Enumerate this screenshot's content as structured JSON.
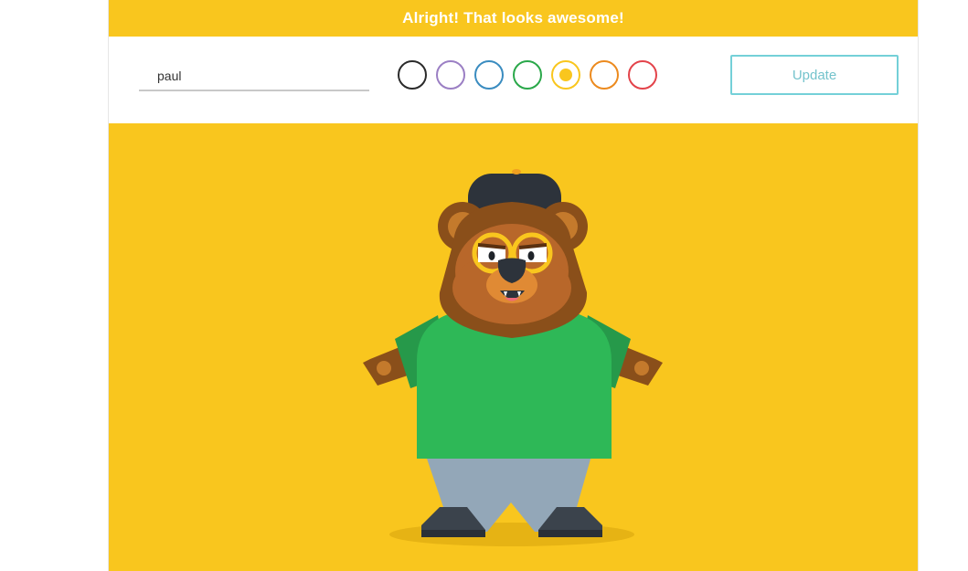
{
  "banner": {
    "message": "Alright! That looks awesome!"
  },
  "toolbar": {
    "name_value": "paul",
    "update_label": "Update"
  },
  "colors": {
    "accent": "#f9c61e",
    "swatches": [
      {
        "name": "black",
        "color": "#2b2b2b",
        "selected": false
      },
      {
        "name": "purple",
        "color": "#9b7fc4",
        "selected": false
      },
      {
        "name": "blue",
        "color": "#3a8cc0",
        "selected": false
      },
      {
        "name": "green",
        "color": "#2aa84a",
        "selected": false
      },
      {
        "name": "yellow",
        "color": "#f9c61e",
        "selected": true
      },
      {
        "name": "orange",
        "color": "#ec8a1e",
        "selected": false
      },
      {
        "name": "red",
        "color": "#e3434a",
        "selected": false
      }
    ]
  },
  "character": {
    "icon": "bear-avatar"
  }
}
